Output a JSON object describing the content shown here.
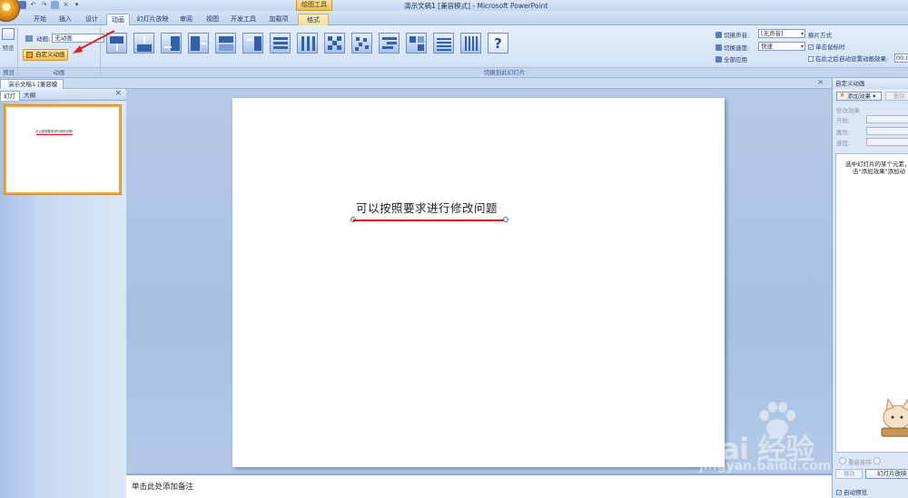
{
  "title_bar": {
    "app_title": "演示文稿1 [兼容模式] - Microsoft PowerPoint",
    "contextual_tool": "绘图工具",
    "qat_icons": [
      "save-icon",
      "undo-icon",
      "redo-icon",
      "print-icon",
      "close-icon",
      "dropdown-icon"
    ]
  },
  "tabs": [
    {
      "label": "开始"
    },
    {
      "label": "插入"
    },
    {
      "label": "设计"
    },
    {
      "label": "动画",
      "active": true
    },
    {
      "label": "幻灯片放映"
    },
    {
      "label": "审阅"
    },
    {
      "label": "视图"
    },
    {
      "label": "开发工具"
    },
    {
      "label": "加载项"
    },
    {
      "label": "格式"
    }
  ],
  "ribbon": {
    "preview": {
      "label": "预览",
      "group": "预览"
    },
    "animations": {
      "animation_label": "动画:",
      "animation_value": "无动画",
      "custom_label": "自定义动画",
      "group": "动画"
    },
    "transitions_group": "切换到此幻灯片",
    "transition_icons": [
      "cover-down-icon",
      "wipe-up-icon",
      "push-left-icon",
      "cover-right-icon",
      "split-icon",
      "box-out-icon",
      "blinds-horizontal-icon",
      "blinds-vertical-icon",
      "checkerboard-icon",
      "dissolve-icon",
      "shape-icon",
      "strips-icon",
      "bars-horizontal-icon",
      "bars-vertical-icon",
      "help-icon"
    ],
    "transition_sound_label": "切换声音:",
    "transition_sound_value": "[无声音]",
    "transition_speed_label": "切换速度:",
    "transition_speed_value": "快速",
    "apply_all_label": "全部应用",
    "advance_title": "换片方式",
    "on_click_label": "单击鼠标时",
    "on_click_checked": true,
    "auto_after_label": "在此之后自动设置动画效果:",
    "auto_after_value": "00:0"
  },
  "document": {
    "tab_label": "演示文稿1 [兼容模式]"
  },
  "left_panel": {
    "tab_slides": "幻灯片",
    "tab_outline": "大纲",
    "thumbnail_title": "可以按照要求进行修改问题"
  },
  "slide": {
    "title": "可以按照要求进行修改问题"
  },
  "notes": {
    "placeholder": "单击此处添加备注"
  },
  "right_panel": {
    "title": "自定义动画",
    "add_effect": "添加效果",
    "remove": "删除",
    "modify_label": "修改效果",
    "start_label": "开始:",
    "property_label": "属性:",
    "speed_label": "速度:",
    "hint_line1": "选中幻灯片的某个元素，",
    "hint_line2": "击\"添加效果\"添加动",
    "reorder_label": "重新排序",
    "play_label": "播放",
    "slideshow_label": "幻灯片放映",
    "autopreview_label": "自动预览",
    "autopreview_checked": true
  },
  "watermark": {
    "brand": "Bai 经验",
    "url": "jingyan.baidu.com"
  },
  "colors": {
    "ribbon_bg": "#dbe7f6",
    "accent_orange": "#f2a54a",
    "title_underline": "#d60000",
    "slide_bg": "#ffffff",
    "workspace_bg": "#b6cae6"
  }
}
